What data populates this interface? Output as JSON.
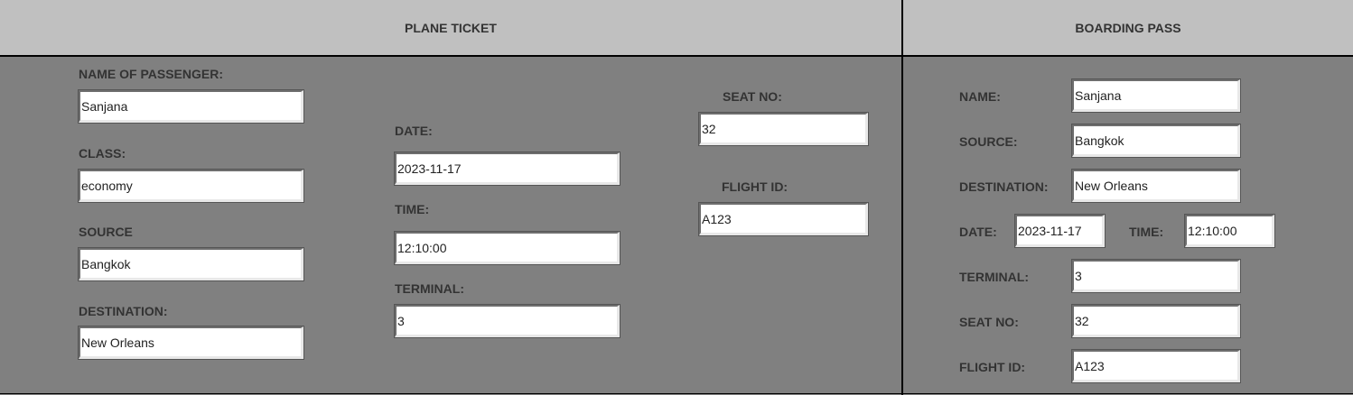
{
  "plane_ticket": {
    "title": "PLANE TICKET",
    "name_label": "NAME OF PASSENGER:",
    "name_value": "Sanjana",
    "class_label": "CLASS:",
    "class_value": "economy",
    "source_label": "SOURCE",
    "source_value": "Bangkok",
    "destination_label": "DESTINATION:",
    "destination_value": "New Orleans",
    "date_label": "DATE:",
    "date_value": "2023-11-17",
    "time_label": "TIME:",
    "time_value": "12:10:00",
    "terminal_label": "TERMINAL:",
    "terminal_value": "3",
    "seat_label": "SEAT NO:",
    "seat_value": "32",
    "flight_label": "FLIGHT ID:",
    "flight_value": "A123"
  },
  "boarding_pass": {
    "title": "BOARDING PASS",
    "name_label": "NAME:",
    "name_value": "Sanjana",
    "source_label": "SOURCE:",
    "source_value": "Bangkok",
    "destination_label": "DESTINATION:",
    "destination_value": "New Orleans",
    "date_label": "DATE:",
    "date_value": "2023-11-17",
    "time_label": "TIME:",
    "time_value": "12:10:00",
    "terminal_label": "TERMINAL:",
    "terminal_value": "3",
    "seat_label": "SEAT NO:",
    "seat_value": "32",
    "flight_label": "FLIGHT ID:",
    "flight_value": "A123"
  }
}
